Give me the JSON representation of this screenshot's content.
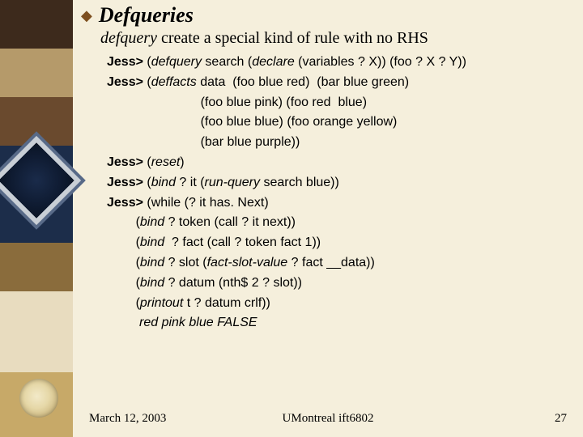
{
  "header": {
    "bullet": "◆",
    "title": "Defqueries",
    "subtitle_kw": "defquery",
    "subtitle_rest": " create a special kind of rule with no RHS"
  },
  "code": {
    "p": "Jess>",
    "l1": {
      "a": " (",
      "fn": "defquery",
      "b": " search (",
      "fn2": "declare",
      "c": " (variables ? X)) (foo ? X ? Y))"
    },
    "l2": {
      "a": " (",
      "fn": "deffacts",
      "b": " data  (foo blue red)  (bar blue green)"
    },
    "l3": "                          (foo blue pink) (foo red  blue)",
    "l4": "                          (foo blue blue) (foo orange yellow)",
    "l5": "                          (bar blue purple))",
    "l6": {
      "a": " (",
      "fn": "reset",
      "b": ")"
    },
    "l7": {
      "a": " (",
      "fn": "bind",
      "b": " ? it (",
      "fn2": "run-query",
      "c": " search blue))"
    },
    "l8": {
      "a": " (while (? it has. Next)"
    },
    "l9": {
      "pad": "        (",
      "fn": "bind",
      "b": " ? token (call ? it next))"
    },
    "l10": {
      "pad": "        (",
      "fn": "bind",
      "b": "  ? fact (call ? token fact 1))"
    },
    "l11": {
      "pad": "        (",
      "fn": "bind",
      "b": " ? slot (",
      "fn2": "fact-slot-value",
      "c": " ? fact __data))"
    },
    "l12": {
      "pad": "        (",
      "fn": "bind",
      "b": " ? datum (nth$ 2 ? slot))"
    },
    "l13": {
      "pad": "        (",
      "fn": "printout",
      "b": " t ? datum crlf))"
    },
    "result": "         red pink blue FALSE"
  },
  "footer": {
    "date": "March 12, 2003",
    "center": "UMontreal ift6802",
    "page": "27"
  }
}
